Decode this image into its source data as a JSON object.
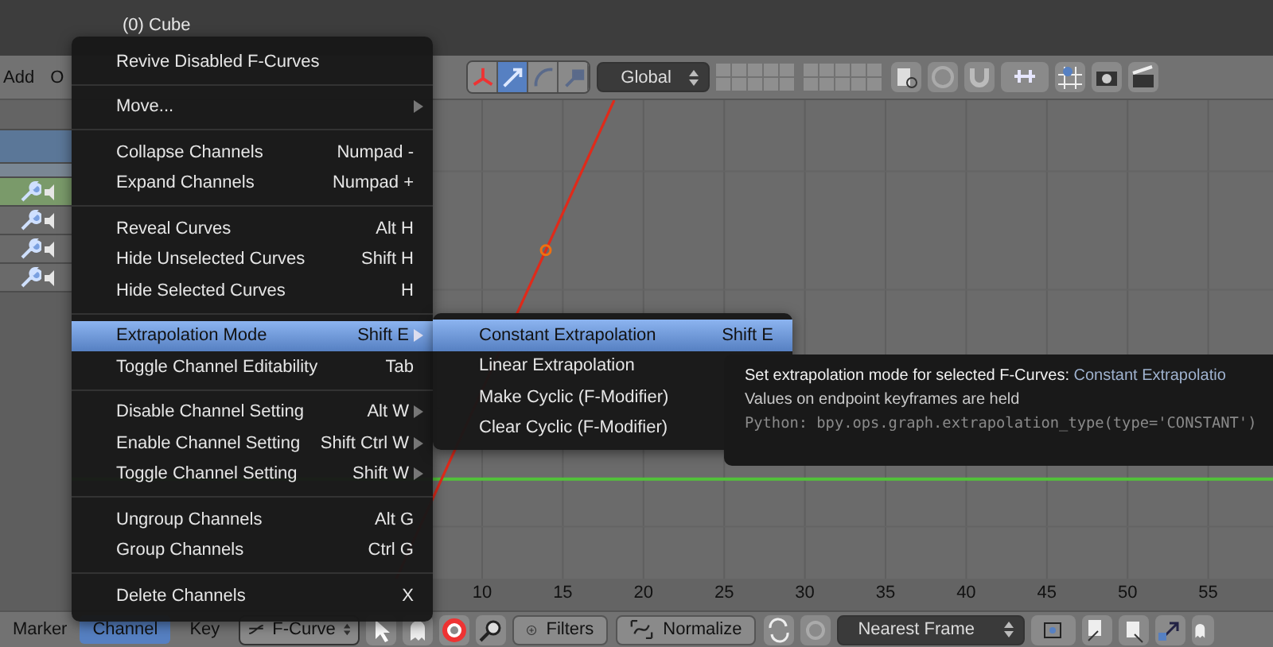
{
  "viewport": {
    "object_label": "(0) Cube"
  },
  "header_menus": [
    {
      "label": "Add"
    },
    {
      "label": "O"
    }
  ],
  "manipulators": [
    {
      "selected": false
    },
    {
      "selected": true
    },
    {
      "selected": false
    },
    {
      "selected": false
    }
  ],
  "orientation": "Global",
  "channels": [
    {
      "kind": "summary"
    },
    {
      "kind": "group"
    },
    {
      "kind": "spacer"
    },
    {
      "kind": "object"
    },
    {
      "kind": "curve"
    },
    {
      "kind": "curve"
    },
    {
      "kind": "curve"
    }
  ],
  "menu": {
    "items": [
      {
        "kind": "item",
        "label": "Revive Disabled F-Curves",
        "selected": false
      },
      {
        "kind": "separator"
      },
      {
        "kind": "item",
        "label": "Move...",
        "submenu": true,
        "selected": false
      },
      {
        "kind": "separator"
      },
      {
        "kind": "item",
        "label": "Collapse Channels",
        "shortcut": "Numpad -",
        "selected": false
      },
      {
        "kind": "item",
        "label": "Expand Channels",
        "shortcut": "Numpad +",
        "selected": false
      },
      {
        "kind": "separator"
      },
      {
        "kind": "item",
        "label": "Reveal Curves",
        "shortcut": "Alt H",
        "selected": false
      },
      {
        "kind": "item",
        "label": "Hide Unselected Curves",
        "shortcut": "Shift H",
        "selected": false
      },
      {
        "kind": "item",
        "label": "Hide Selected Curves",
        "shortcut": "H",
        "selected": false
      },
      {
        "kind": "separator"
      },
      {
        "kind": "item",
        "label": "Extrapolation Mode",
        "shortcut": "Shift E",
        "submenu": true,
        "selected": true
      },
      {
        "kind": "item",
        "label": "Toggle Channel Editability",
        "shortcut": "Tab",
        "selected": false
      },
      {
        "kind": "separator"
      },
      {
        "kind": "item",
        "label": "Disable Channel Setting",
        "shortcut": "Alt W",
        "submenu": true,
        "selected": false
      },
      {
        "kind": "item",
        "label": "Enable Channel Setting",
        "shortcut": "Shift Ctrl W",
        "submenu": true,
        "selected": false
      },
      {
        "kind": "item",
        "label": "Toggle Channel Setting",
        "shortcut": "Shift W",
        "submenu": true,
        "selected": false
      },
      {
        "kind": "separator"
      },
      {
        "kind": "item",
        "label": "Ungroup Channels",
        "shortcut": "Alt G",
        "selected": false
      },
      {
        "kind": "item",
        "label": "Group Channels",
        "shortcut": "Ctrl G",
        "selected": false
      },
      {
        "kind": "separator"
      },
      {
        "kind": "item",
        "label": "Delete Channels",
        "shortcut": "X",
        "selected": false
      }
    ]
  },
  "submenu": {
    "items": [
      {
        "label": "Constant Extrapolation",
        "shortcut": "Shift E",
        "selected": true
      },
      {
        "label": "Linear Extrapolation",
        "selected": false
      },
      {
        "label": "Make Cyclic (F-Modifier)",
        "selected": false
      },
      {
        "label": "Clear Cyclic (F-Modifier)",
        "selected": false
      }
    ]
  },
  "tooltip": {
    "title": "Set extrapolation mode for selected F-Curves:",
    "value": "Constant Extrapolatio",
    "description": "Values on endpoint keyframes are held",
    "python": "Python: bpy.ops.graph.extrapolation_type(type='CONSTANT')"
  },
  "ruler": {
    "ticks": [
      "10",
      "15",
      "20",
      "25",
      "30",
      "35",
      "40",
      "45",
      "50",
      "55"
    ]
  },
  "bottom_bar": {
    "menus": [
      {
        "label": "Marker",
        "selected": false
      },
      {
        "label": "Channel",
        "selected": true
      },
      {
        "label": "Key",
        "selected": false
      }
    ],
    "mode": "F-Curve",
    "filters": "Filters",
    "normalize": "Normalize",
    "snap": "Nearest Frame"
  }
}
